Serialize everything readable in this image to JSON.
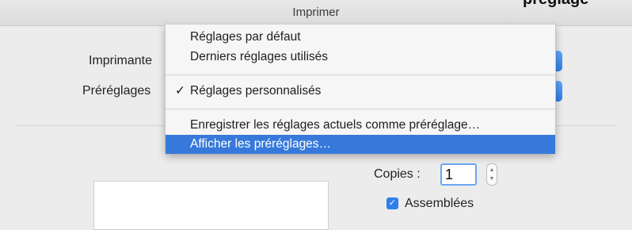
{
  "window": {
    "title": "Imprimer",
    "cut_heading": "préglage"
  },
  "form": {
    "printer_label": "Imprimante",
    "presets_label": "Préréglages",
    "copies_label": "Copies :",
    "copies_value": "1",
    "collated_label": "Assemblées",
    "collated_checked": true
  },
  "menu": {
    "items": [
      {
        "label": "Réglages par défaut",
        "checked": false,
        "highlighted": false
      },
      {
        "label": "Derniers réglages utilisés",
        "checked": false,
        "highlighted": false
      },
      {
        "label": "Réglages personnalisés",
        "checked": true,
        "highlighted": false
      },
      {
        "label": "Enregistrer les réglages actuels comme préréglage…",
        "checked": false,
        "highlighted": false
      },
      {
        "label": "Afficher les préréglages…",
        "checked": false,
        "highlighted": true
      }
    ],
    "check_glyph": "✓"
  },
  "icons": {
    "stepper": "stepper-icon",
    "checkmark": "checkmark-icon"
  },
  "colors": {
    "accent": "#3779db",
    "popup": "#2a7de6"
  }
}
